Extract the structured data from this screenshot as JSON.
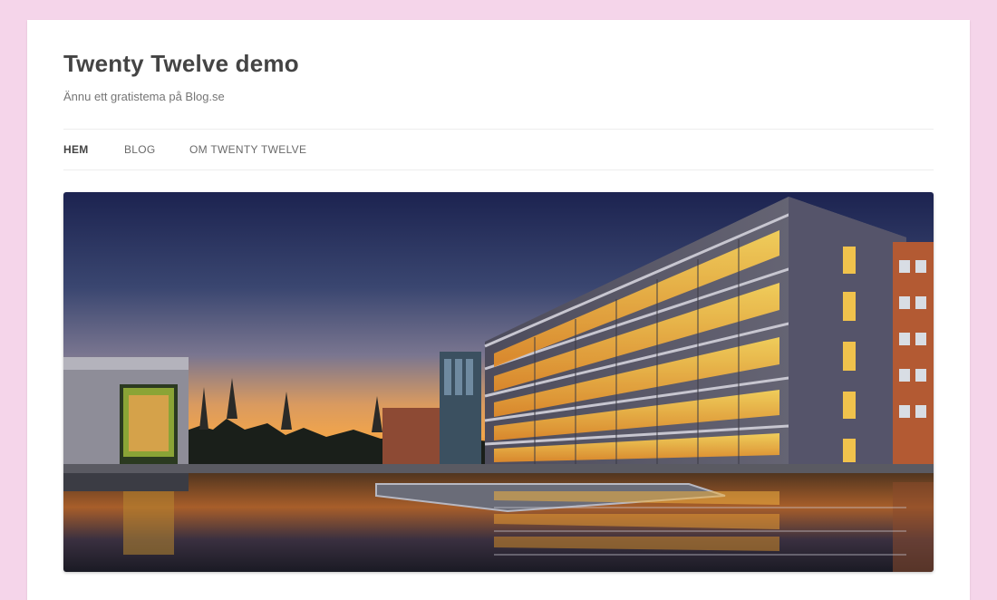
{
  "site": {
    "title": "Twenty Twelve demo",
    "description": "Ännu ett gratistema på Blog.se"
  },
  "nav": {
    "items": [
      {
        "label": "Hem",
        "current": true
      },
      {
        "label": "Blog",
        "current": false
      },
      {
        "label": "Om Twenty Twelve",
        "current": false
      }
    ]
  },
  "header_image": {
    "subject": "modern office building at dusk reflected in water"
  },
  "colors": {
    "page_background": "#f5d5ea",
    "content_background": "#ffffff",
    "title_text": "#444444",
    "nav_text": "#6a6a6a"
  }
}
